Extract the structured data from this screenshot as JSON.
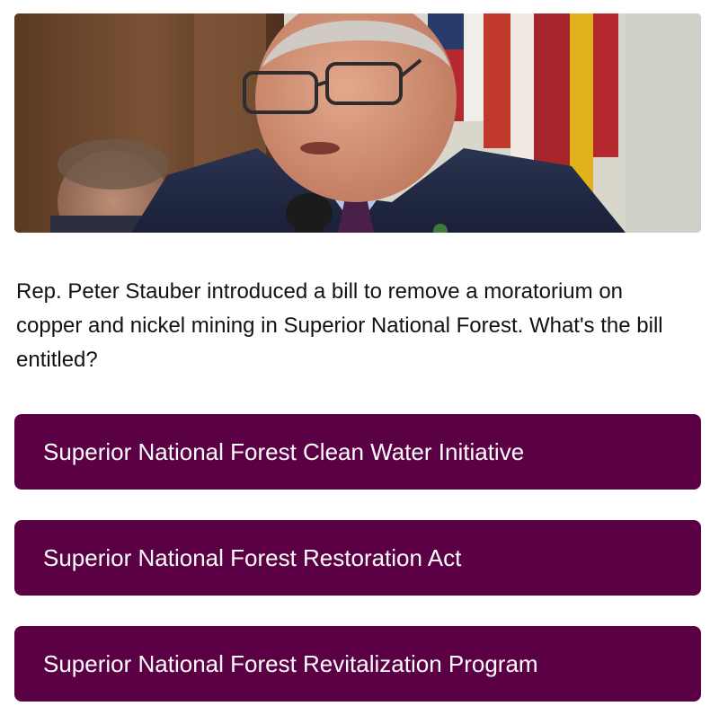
{
  "question": {
    "text": "Rep. Peter Stauber introduced a bill to remove a moratorium on copper and nickel mining in Superior National Forest. What's the bill entitled?"
  },
  "answers": [
    {
      "label": "Superior National Forest Clean Water Initiative"
    },
    {
      "label": "Superior National Forest Restoration Act"
    },
    {
      "label": "Superior National Forest Revitalization Program"
    }
  ],
  "colors": {
    "answer_background": "#5c0046",
    "answer_text": "#ffffff",
    "question_text": "#121212"
  }
}
